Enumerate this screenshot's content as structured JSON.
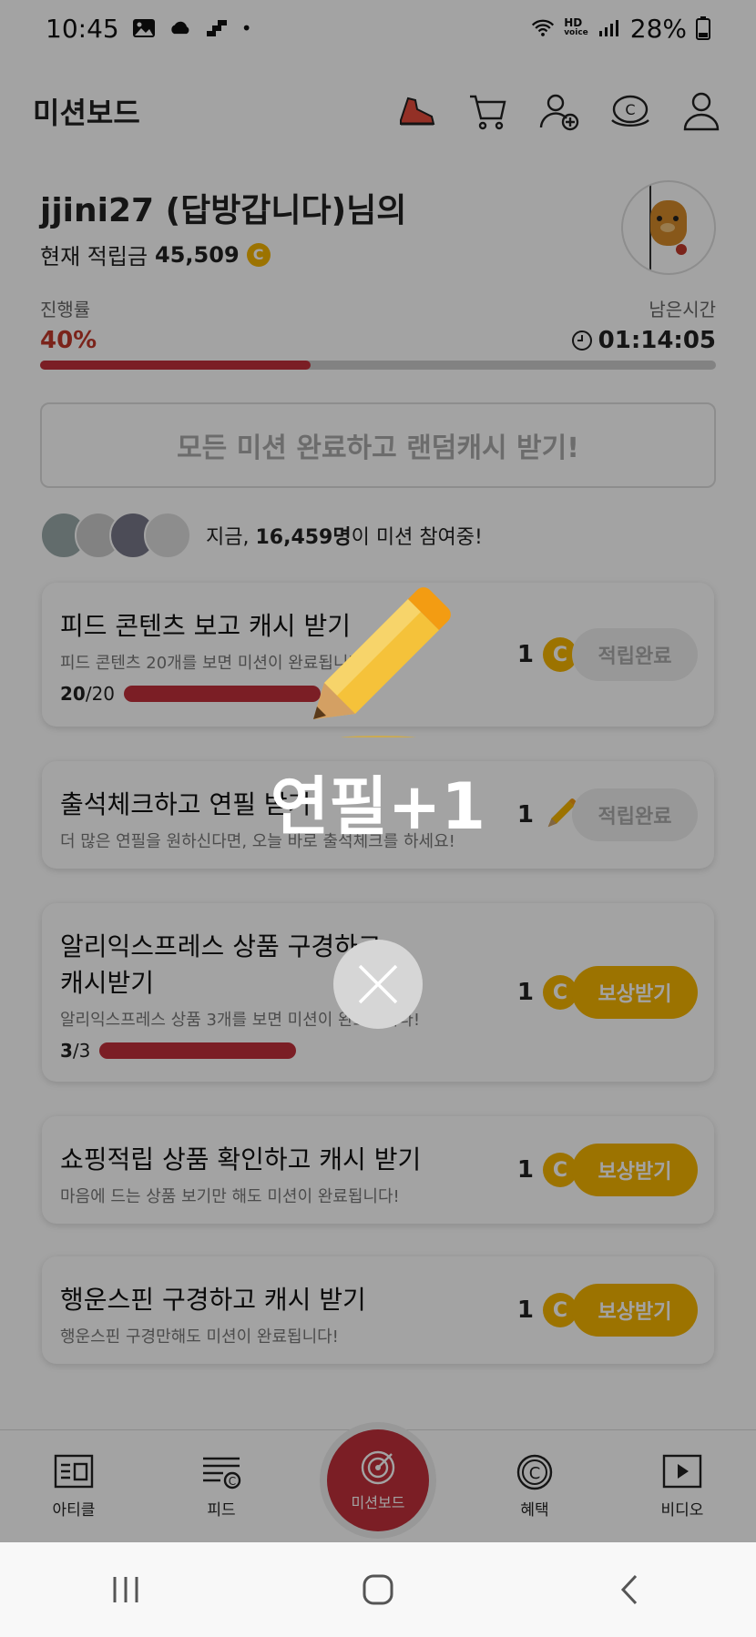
{
  "status_bar": {
    "time": "10:45",
    "battery": "28%",
    "hd_label": "HD",
    "voice_label": "voice"
  },
  "header": {
    "title": "미션보드"
  },
  "user": {
    "greeting": "jjini27 (답방갑니다)님의",
    "balance_label": "현재 적립금",
    "balance_value": "45,509",
    "coin_symbol": "C"
  },
  "progress": {
    "label": "진행률",
    "value": "40%",
    "fraction": 0.4,
    "time_label": "남은시간",
    "time_value": "01:14:05"
  },
  "complete_banner": "모든 미션 완료하고 랜덤캐시 받기!",
  "participants": {
    "prefix": "지금, ",
    "count": "16,459명",
    "suffix": "이 미션 참여중!"
  },
  "missions": [
    {
      "title": "피드 콘텐츠 보고 캐시 받기",
      "desc": "피드 콘텐츠 20개를 보면 미션이 완료됩니다!",
      "progress_done": "20",
      "progress_total": "/20",
      "reward": "1",
      "button": "적립완료"
    },
    {
      "title": "출석체크하고 연필 받기",
      "desc": "더 많은 연필을 원하신다면, 오늘 바로 출석체크를 하세요!",
      "reward": "1",
      "button": "적립완료"
    },
    {
      "title": "알리익스프레스 상품 구경하고",
      "title2": "캐시받기",
      "desc": "알리익스프레스 상품 3개를 보면 미션이 완료됩니다!",
      "progress_done": "3",
      "progress_total": "/3",
      "reward": "1",
      "button": "보상받기"
    },
    {
      "title": "쇼핑적립 상품 확인하고 캐시 받기",
      "desc": "마음에 드는 상품 보기만 해도 미션이 완료됩니다!",
      "reward": "1",
      "button": "보상받기"
    },
    {
      "title": "행운스핀 구경하고 캐시 받기",
      "desc": "행운스핀 구경만해도 미션이 완료됩니다!",
      "reward": "1",
      "button": "보상받기"
    }
  ],
  "popup": {
    "label": "연필+1"
  },
  "bottom_nav": {
    "article": "아티클",
    "feed": "피드",
    "missionboard": "미션보드",
    "benefit": "혜택",
    "video": "비디오"
  },
  "colors": {
    "accent_red": "#c0303a",
    "coin_gold": "#f5b400"
  }
}
